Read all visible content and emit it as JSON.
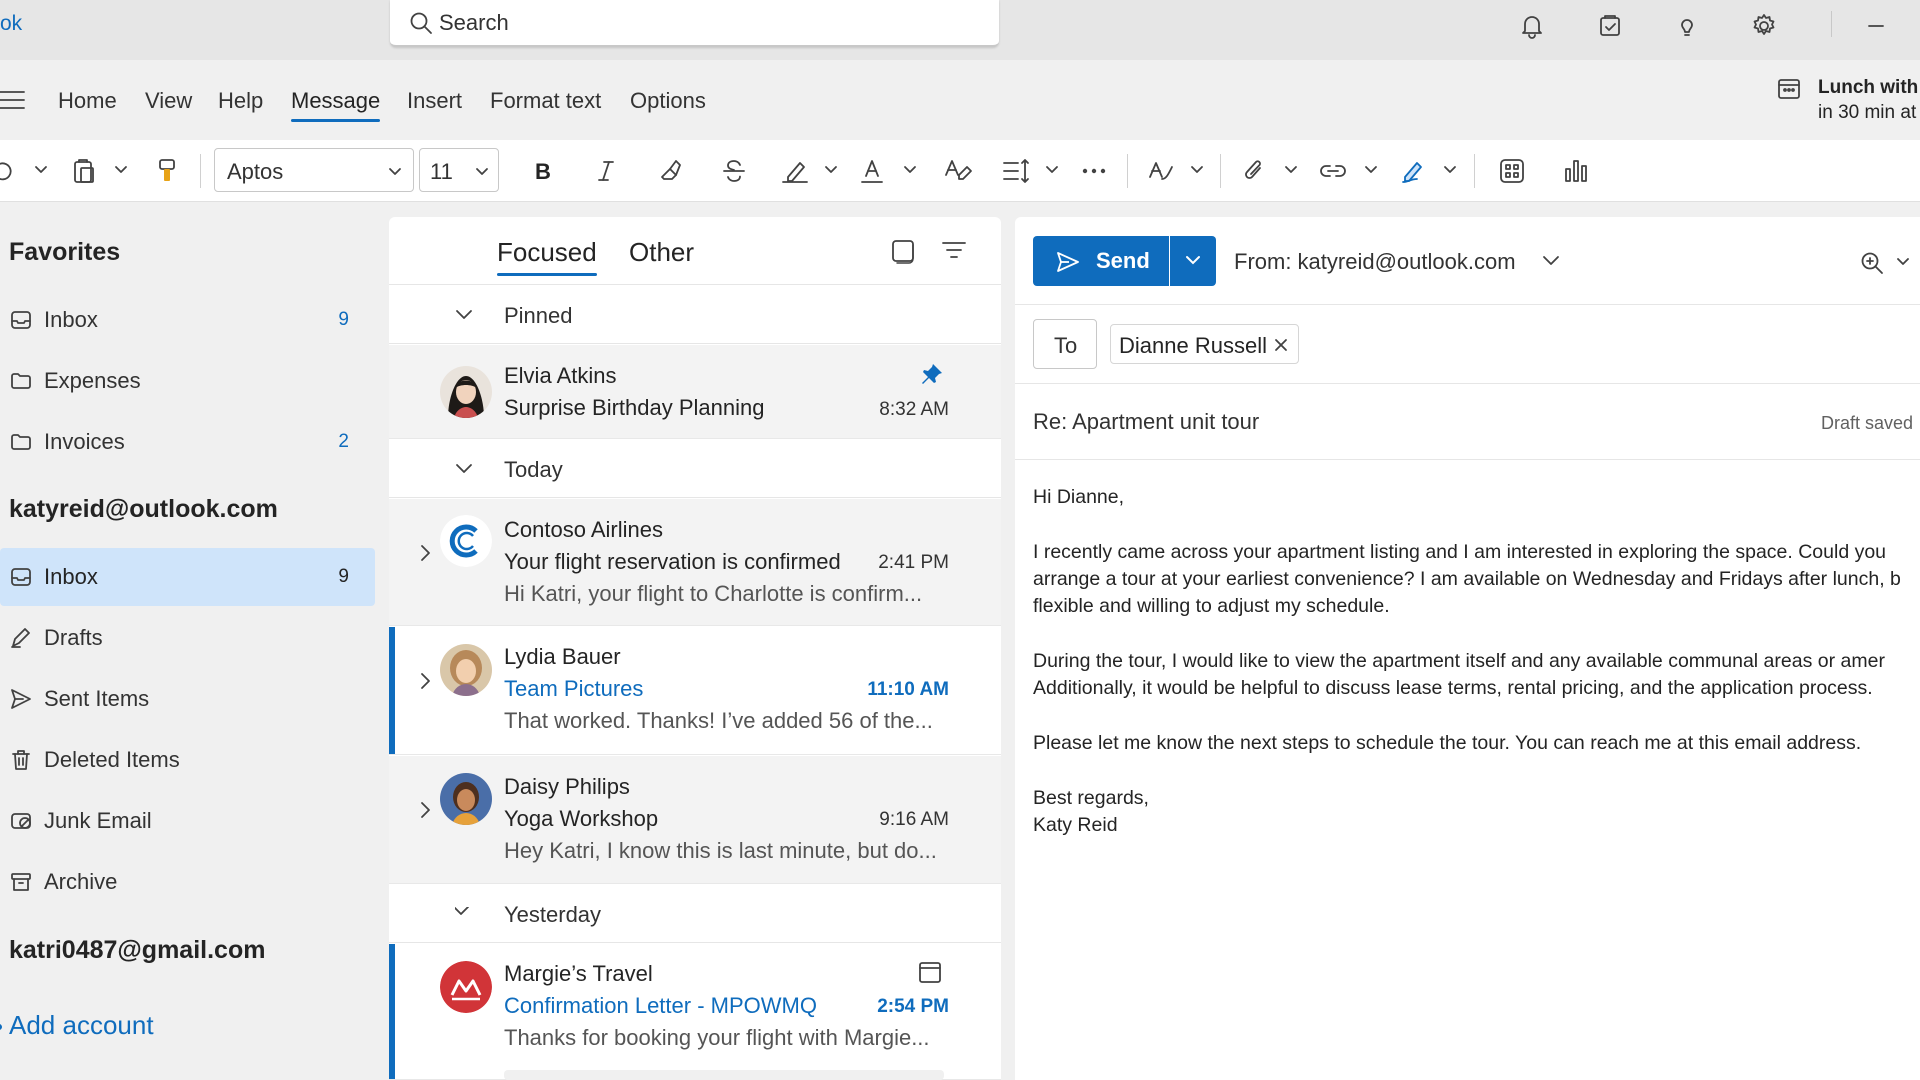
{
  "app": {
    "name_fragment": "ok"
  },
  "search": {
    "placeholder": "Search"
  },
  "titlebar_icons": [
    "bell-icon",
    "clipboard-check-icon",
    "lightbulb-icon",
    "settings-icon",
    "minimize-icon"
  ],
  "menu": {
    "tabs": [
      "Home",
      "View",
      "Help",
      "Message",
      "Insert",
      "Format text",
      "Options"
    ],
    "active": "Message"
  },
  "reminder": {
    "title": "Lunch with ",
    "subtitle": "in 30 min at"
  },
  "ribbon": {
    "font_name": "Aptos",
    "font_size": "11"
  },
  "nav": {
    "favorites_title": "Favorites",
    "favorites": [
      {
        "label": "Inbox",
        "count": "9",
        "icon": "inbox-icon"
      },
      {
        "label": "Expenses",
        "count": "",
        "icon": "folder-icon"
      },
      {
        "label": "Invoices",
        "count": "2",
        "icon": "folder-icon"
      }
    ],
    "account1": "katyreid@outlook.com",
    "account1_folders": [
      {
        "label": "Inbox",
        "count": "9",
        "icon": "inbox-icon",
        "selected": true
      },
      {
        "label": "Drafts",
        "count": "",
        "icon": "drafts-icon"
      },
      {
        "label": "Sent Items",
        "count": "",
        "icon": "send-icon"
      },
      {
        "label": "Deleted Items",
        "count": "",
        "icon": "trash-icon"
      },
      {
        "label": "Junk Email",
        "count": "",
        "icon": "junk-icon"
      },
      {
        "label": "Archive",
        "count": "",
        "icon": "archive-icon"
      }
    ],
    "account2": "katri0487@gmail.com",
    "add_account": "Add account"
  },
  "list": {
    "tabs": {
      "focused": "Focused",
      "other": "Other"
    },
    "groups": {
      "pinned": "Pinned",
      "today": "Today",
      "yesterday": "Yesterday"
    },
    "messages": [
      {
        "sender": "Elvia Atkins",
        "subject": "Surprise Birthday Planning",
        "preview": "",
        "time": "8:32 AM",
        "pinned": true
      },
      {
        "sender": "Contoso Airlines",
        "subject": "Your flight reservation is confirmed",
        "preview": "Hi Katri, your flight to Charlotte is confirm...",
        "time": "2:41 PM"
      },
      {
        "sender": "Lydia Bauer",
        "subject": "Team Pictures",
        "preview": "That worked. Thanks! I’ve added 56 of the...",
        "time": "11:10 AM",
        "unread": true
      },
      {
        "sender": "Daisy Philips",
        "subject": "Yoga Workshop",
        "preview": "Hey Katri, I know this is last minute, but do...",
        "time": "9:16 AM"
      },
      {
        "sender": "Margie’s Travel",
        "subject": "Confirmation Letter - MPOWMQ",
        "preview": "Thanks for booking your flight with Margie...",
        "time": "2:54 PM",
        "unread": true
      }
    ]
  },
  "compose": {
    "send_label": "Send",
    "from": "From: katyreid@outlook.com",
    "to_label": "To",
    "recipient": "Dianne Russell",
    "subject": "Re: Apartment unit tour",
    "draft_status": "Draft saved",
    "body": [
      "Hi Dianne,",
      "I recently came across your apartment listing and I am interested in exploring the space. Could you",
      "arrange a tour at your earliest convenience? I am available on Wednesday and Fridays after lunch, b",
      "flexible and willing to adjust my schedule.",
      "During the tour, I would like to view the apartment itself and any available communal areas or amer",
      "Additionally, it would be helpful to discuss lease terms, rental pricing, and the application process.",
      "Please let me know the next steps to schedule the tour. You can reach me at this email address.",
      "Best regards,",
      "Katy Reid"
    ]
  },
  "colors": {
    "accent": "#0f6cbd",
    "selected_bg": "#cfe4fa"
  }
}
